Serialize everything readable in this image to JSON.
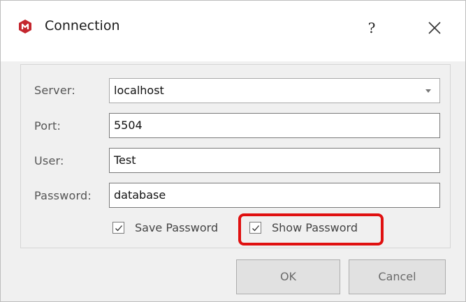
{
  "window": {
    "title": "Connection",
    "help_label": "?",
    "icons": {
      "app": "app-logo-icon",
      "close": "close-icon"
    },
    "colors": {
      "accent_icon": "#c4262e",
      "highlight": "#e01010"
    }
  },
  "form": {
    "server": {
      "label": "Server:",
      "value": "localhost"
    },
    "port": {
      "label": "Port:",
      "value": "5504"
    },
    "user": {
      "label": "User:",
      "value": "Test"
    },
    "password": {
      "label": "Password:",
      "value": "database"
    },
    "save_password": {
      "label": "Save Password",
      "checked": true
    },
    "show_password": {
      "label": "Show Password",
      "checked": true
    }
  },
  "buttons": {
    "ok": "OK",
    "cancel": "Cancel"
  }
}
